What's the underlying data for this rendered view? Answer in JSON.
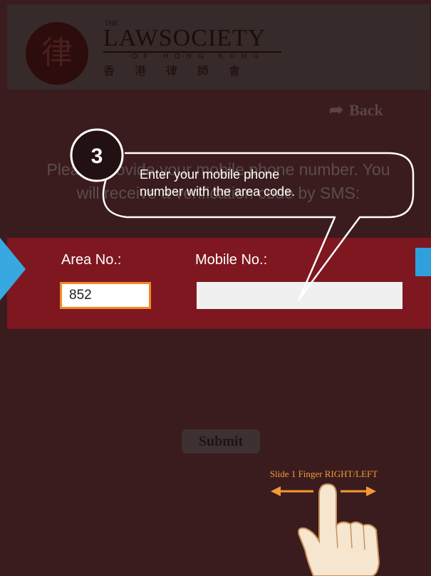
{
  "header": {
    "logo_the": "THE",
    "logo_main": "LAWSOCIETY",
    "logo_sub": "OF HONG KONG",
    "logo_cn": "香港律師會"
  },
  "nav": {
    "back_label": "Back"
  },
  "instruction": {
    "line1": "Please provide your mobile phone number. You",
    "line2": "will receive a verification code by SMS:"
  },
  "form": {
    "area_label": "Area No.:",
    "area_value": "852",
    "mobile_label": "Mobile No.:",
    "mobile_value": "",
    "submit_label": "Submit"
  },
  "tutorial": {
    "step_number": "3",
    "step_text_line1": "Enter your mobile phone",
    "step_text_line2": "number with the area code.",
    "gesture_hint": "Slide 1 Finger RIGHT/LEFT"
  },
  "colors": {
    "accent_band": "#7e1720",
    "area_border": "#f08a24",
    "cyan_arrow": "#37a9e0",
    "gesture_orange": "#f49a33"
  }
}
